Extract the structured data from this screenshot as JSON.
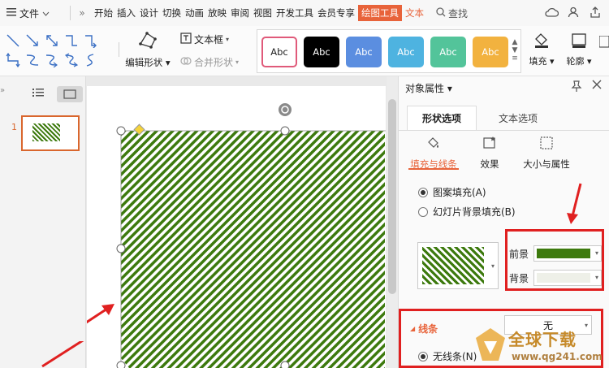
{
  "menu": {
    "file_label": "文件",
    "more_glyph": "»",
    "tabs": [
      "开始",
      "插入",
      "设计",
      "切换",
      "动画",
      "放映",
      "审阅",
      "视图",
      "开发工具",
      "会员专享"
    ],
    "active_tab": "绘图工具",
    "next_tab": "文本",
    "search_label": "查找"
  },
  "ribbon": {
    "edit_shape_label": "编辑形状",
    "textbox_label": "文本框",
    "merge_shape_label": "合并形状",
    "style_label": "Abc",
    "style_colors": [
      "#ffffff",
      "#000000",
      "#5b8ee0",
      "#4eb3e0",
      "#53c49a",
      "#f2b23f"
    ],
    "fill_label": "填充",
    "outline_label": "轮廓"
  },
  "slides": {
    "slide_number": "1"
  },
  "shape": {
    "pattern_foreground": "#3d7a0e",
    "pattern_background": "#ffffff"
  },
  "panel": {
    "title": "对象属性",
    "tabs": [
      "形状选项",
      "文本选项"
    ],
    "subtabs": [
      "填充与线条",
      "效果",
      "大小与属性"
    ],
    "fill_options": {
      "pattern_fill": "图案填充(A)",
      "slide_bg_fill": "幻灯片背景填充(B)"
    },
    "foreground_label": "前景",
    "background_label": "背景",
    "foreground_color": "#3d7a0e",
    "background_color": "#eef0e8",
    "line_section": {
      "title": "线条",
      "value": "无",
      "no_line_label": "无线条(N)"
    }
  },
  "watermark": {
    "text": "全球下载",
    "url": "www.qg241.com"
  },
  "annotation_color": "#e02020"
}
